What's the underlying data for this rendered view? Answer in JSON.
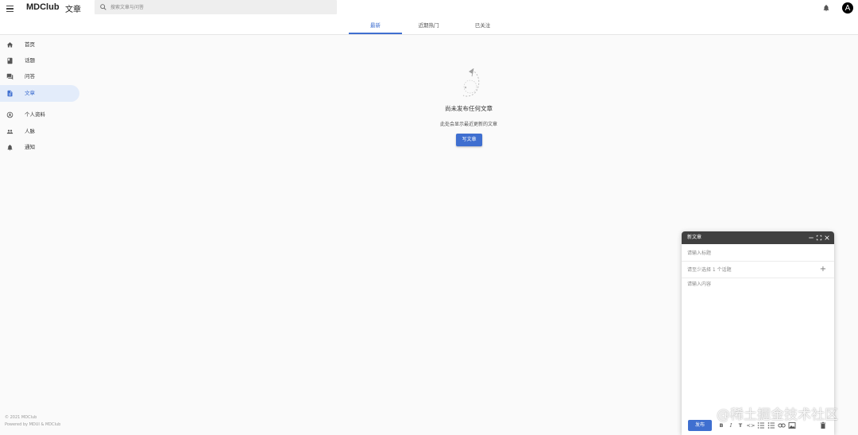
{
  "app": {
    "brand": "MDClub",
    "page_title": "文章",
    "search_placeholder": "搜索文章与问答",
    "avatar_letter": "A"
  },
  "tabs": [
    {
      "label": "最新",
      "active": true
    },
    {
      "label": "近期热门",
      "active": false
    },
    {
      "label": "已关注",
      "active": false
    }
  ],
  "sidebar": {
    "items": [
      {
        "label": "首页",
        "icon": "home-icon"
      },
      {
        "label": "话题",
        "icon": "book-icon"
      },
      {
        "label": "问答",
        "icon": "forum-icon"
      },
      {
        "label": "文章",
        "icon": "article-icon",
        "active": true
      },
      {
        "label": "个人资料",
        "icon": "account-circle-icon"
      },
      {
        "label": "人脉",
        "icon": "people-icon"
      },
      {
        "label": "通知",
        "icon": "bell-icon"
      }
    ]
  },
  "footer": {
    "copyright": "© 2021 MDClub",
    "powered": "Powered by MDUI & MDClub"
  },
  "empty_state": {
    "title": "尚未发布任何文章",
    "subtitle": "此处会显示最近更新的文章",
    "button": "写文章"
  },
  "editor": {
    "title": "新文章",
    "title_placeholder": "请输入标题",
    "topic_placeholder": "请至少选择 1 个话题",
    "content_placeholder": "请输入内容",
    "publish_label": "发布",
    "toolbar": [
      "bold-icon",
      "italic-icon",
      "heading-icon",
      "code-icon",
      "ordered-list-icon",
      "bulleted-list-icon",
      "link-icon",
      "image-icon",
      "delete-icon"
    ]
  },
  "watermark": "@稀土掘金技术社区",
  "colors": {
    "accent": "#3f6fd0",
    "active_nav_bg": "#e3ecfa",
    "editor_header": "#404040",
    "background": "#fafafa"
  }
}
